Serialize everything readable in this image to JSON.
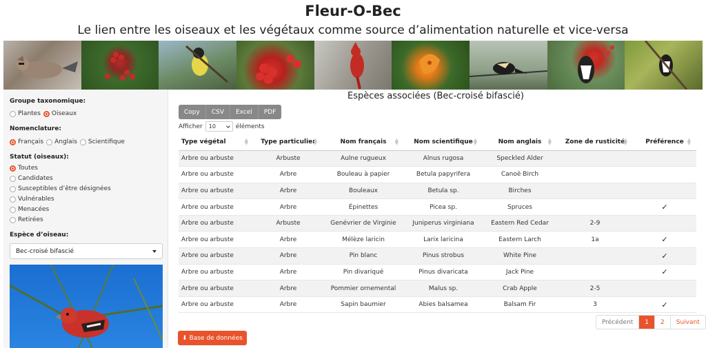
{
  "header": {
    "title": "Fleur-O-Bec",
    "subtitle": "Le lien entre les oiseaux et les végétaux comme source d’alimentation naturelle et vice-versa"
  },
  "sidebar": {
    "taxo_label": "Groupe taxonomique:",
    "taxo_options": [
      "Plantes",
      "Oiseaux"
    ],
    "taxo_selected": 1,
    "nomen_label": "Nomenclature:",
    "nomen_options": [
      "Français",
      "Anglais",
      "Scientifique"
    ],
    "nomen_selected": 0,
    "status_label": "Statut (oiseaux):",
    "status_options": [
      "Toutes",
      "Candidates",
      "Susceptibles d’être désignées",
      "Vulnérables",
      "Menacées",
      "Retirées"
    ],
    "status_selected": 0,
    "species_label": "Espèce d’oiseau:",
    "species_value": "Bec-croisé bifascié"
  },
  "main": {
    "title": "Espèces associées (Bec-croisé bifascié)",
    "export_buttons": [
      "Copy",
      "CSV",
      "Excel",
      "PDF"
    ],
    "length_prefix": "Afficher",
    "length_value": "10",
    "length_suffix": "éléments",
    "columns": [
      "Type végétal",
      "Type particulier",
      "Nom français",
      "Nom scientifique",
      "Nom anglais",
      "Zone de rusticité",
      "Préférence"
    ],
    "rows": [
      [
        "Arbre ou arbuste",
        "Arbuste",
        "Aulne rugueux",
        "Alnus rugosa",
        "Speckled Alder",
        "",
        ""
      ],
      [
        "Arbre ou arbuste",
        "Arbre",
        "Bouleau à papier",
        "Betula papyrifera",
        "Canoë Birch",
        "",
        ""
      ],
      [
        "Arbre ou arbuste",
        "Arbre",
        "Bouleaux",
        "Betula sp.",
        "Birches",
        "",
        ""
      ],
      [
        "Arbre ou arbuste",
        "Arbre",
        "Épinettes",
        "Picea sp.",
        "Spruces",
        "",
        "✓"
      ],
      [
        "Arbre ou arbuste",
        "Arbuste",
        "Genévrier de Virginie",
        "Juniperus virginiana",
        "Eastern Red Cedar",
        "2-9",
        ""
      ],
      [
        "Arbre ou arbuste",
        "Arbre",
        "Mélèze laricin",
        "Larix laricina",
        "Eastern Larch",
        "1a",
        "✓"
      ],
      [
        "Arbre ou arbuste",
        "Arbre",
        "Pin blanc",
        "Pinus strobus",
        "White Pine",
        "",
        "✓"
      ],
      [
        "Arbre ou arbuste",
        "Arbre",
        "Pin divariqué",
        "Pinus divaricata",
        "Jack Pine",
        "",
        "✓"
      ],
      [
        "Arbre ou arbuste",
        "Arbre",
        "Pommier ornemental",
        "Malus sp.",
        "Crab Apple",
        "2-5",
        ""
      ],
      [
        "Arbre ou arbuste",
        "Arbre",
        "Sapin baumier",
        "Abies balsamea",
        "Balsam Fir",
        "3",
        "✓"
      ]
    ],
    "pager": {
      "prev": "Précédent",
      "pages": [
        "1",
        "2"
      ],
      "active": 0,
      "next": "Suivant"
    },
    "db_button": "Base de données"
  },
  "colors": {
    "accent": "#e8532b",
    "export_bg": "#888888",
    "sidebar_bg": "#f5f5f5"
  },
  "icons": {
    "download": "download-icon",
    "dropdown": "chevron-down-icon"
  }
}
